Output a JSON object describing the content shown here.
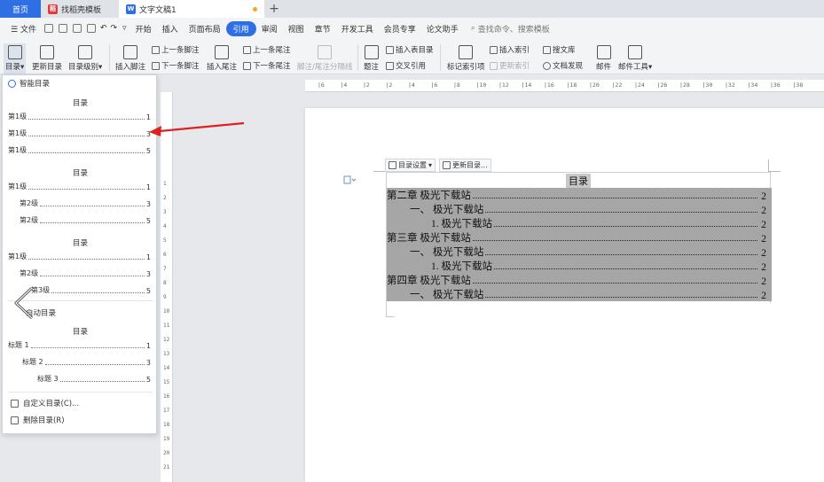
{
  "tabs": [
    {
      "label": "首页"
    },
    {
      "label": "找稻壳模板",
      "logo": "稻"
    },
    {
      "label": "文字文稿1",
      "logo": "W"
    }
  ],
  "menubar": {
    "file": "文件",
    "items": [
      "开始",
      "插入",
      "页面布局",
      "引用",
      "审阅",
      "视图",
      "章节",
      "开发工具",
      "会员专享",
      "论文助手"
    ],
    "active_item": "引用",
    "search": "查找命令、搜索模板"
  },
  "ribbon": {
    "toc": "目录",
    "update_toc": "更新目录",
    "toc_level": "目录级别",
    "insert_footnote": "插入脚注",
    "prev_footnote": "上一条脚注",
    "next_footnote": "下一条脚注",
    "insert_endnote": "插入尾注",
    "prev_endnote": "上一条尾注",
    "next_endnote": "下一条尾注",
    "separator": "脚注/尾注分隔线",
    "caption": "题注",
    "insert_fig_toc": "插入表目录",
    "cross_ref": "交叉引用",
    "mark_index": "标记索引项",
    "insert_index": "插入索引",
    "update_index": "更新索引",
    "search_lit": "搜文库",
    "publish": "文档发现",
    "mail": "邮件",
    "mail_tools": "邮件工具"
  },
  "panel": {
    "smart_toc": "智能目录",
    "auto_toc": "自动目录",
    "heading": "目录",
    "group1": [
      {
        "text": "第1级",
        "page": "1"
      },
      {
        "text": "第1级",
        "page": "3"
      },
      {
        "text": "第1级",
        "page": "5"
      }
    ],
    "group2": [
      {
        "text": "第1级",
        "page": "1"
      },
      {
        "text": "第2级",
        "page": "3"
      },
      {
        "text": "第2级",
        "page": "5"
      }
    ],
    "group3": [
      {
        "text": "第1级",
        "page": "1"
      },
      {
        "text": "第2级",
        "page": "3"
      },
      {
        "text": "第3级",
        "page": "5"
      }
    ],
    "group4": [
      {
        "text": "标题 1",
        "page": "1"
      },
      {
        "text": "标题 2",
        "page": "3"
      },
      {
        "text": "标题 3",
        "page": "5"
      }
    ],
    "custom_toc": "自定义目录(C)...",
    "delete_toc": "删除目录(R)"
  },
  "ruler": {
    "h_ticks": [
      "6",
      "4",
      "2",
      "2",
      "4",
      "6",
      "8",
      "10",
      "12",
      "14",
      "16",
      "18",
      "20",
      "22",
      "24",
      "26",
      "28",
      "30",
      "32",
      "34",
      "36",
      "38"
    ],
    "v_ticks": [
      "1",
      "2",
      "3",
      "4",
      "5",
      "6",
      "7",
      "8",
      "9",
      "10",
      "11",
      "12",
      "13",
      "14",
      "15",
      "16",
      "17",
      "18",
      "19",
      "20",
      "21"
    ]
  },
  "doc": {
    "toc_settings": "目录设置",
    "update_toc": "更新目录...",
    "toc_title": "目录",
    "lines": [
      {
        "text": "第二章  极光下载站",
        "page": "2",
        "indent": 0
      },
      {
        "text": "一、 极光下载站",
        "page": "2",
        "indent": 1
      },
      {
        "text": "1.   极光下载站",
        "page": "2",
        "indent": 2
      },
      {
        "text": "第三章  极光下载站",
        "page": "2",
        "indent": 0
      },
      {
        "text": "一、 极光下载站",
        "page": "2",
        "indent": 1
      },
      {
        "text": "1.   极光下载站",
        "page": "2",
        "indent": 2
      },
      {
        "text": "第四章  极光下载站",
        "page": "2",
        "indent": 0
      },
      {
        "text": "一、 极光下载站",
        "page": "2",
        "indent": 1
      }
    ]
  },
  "colors": {
    "accent": "#2f6fe4",
    "annotation_arrow": "#e02020",
    "toc_field_shade": "#a6a6a6"
  }
}
